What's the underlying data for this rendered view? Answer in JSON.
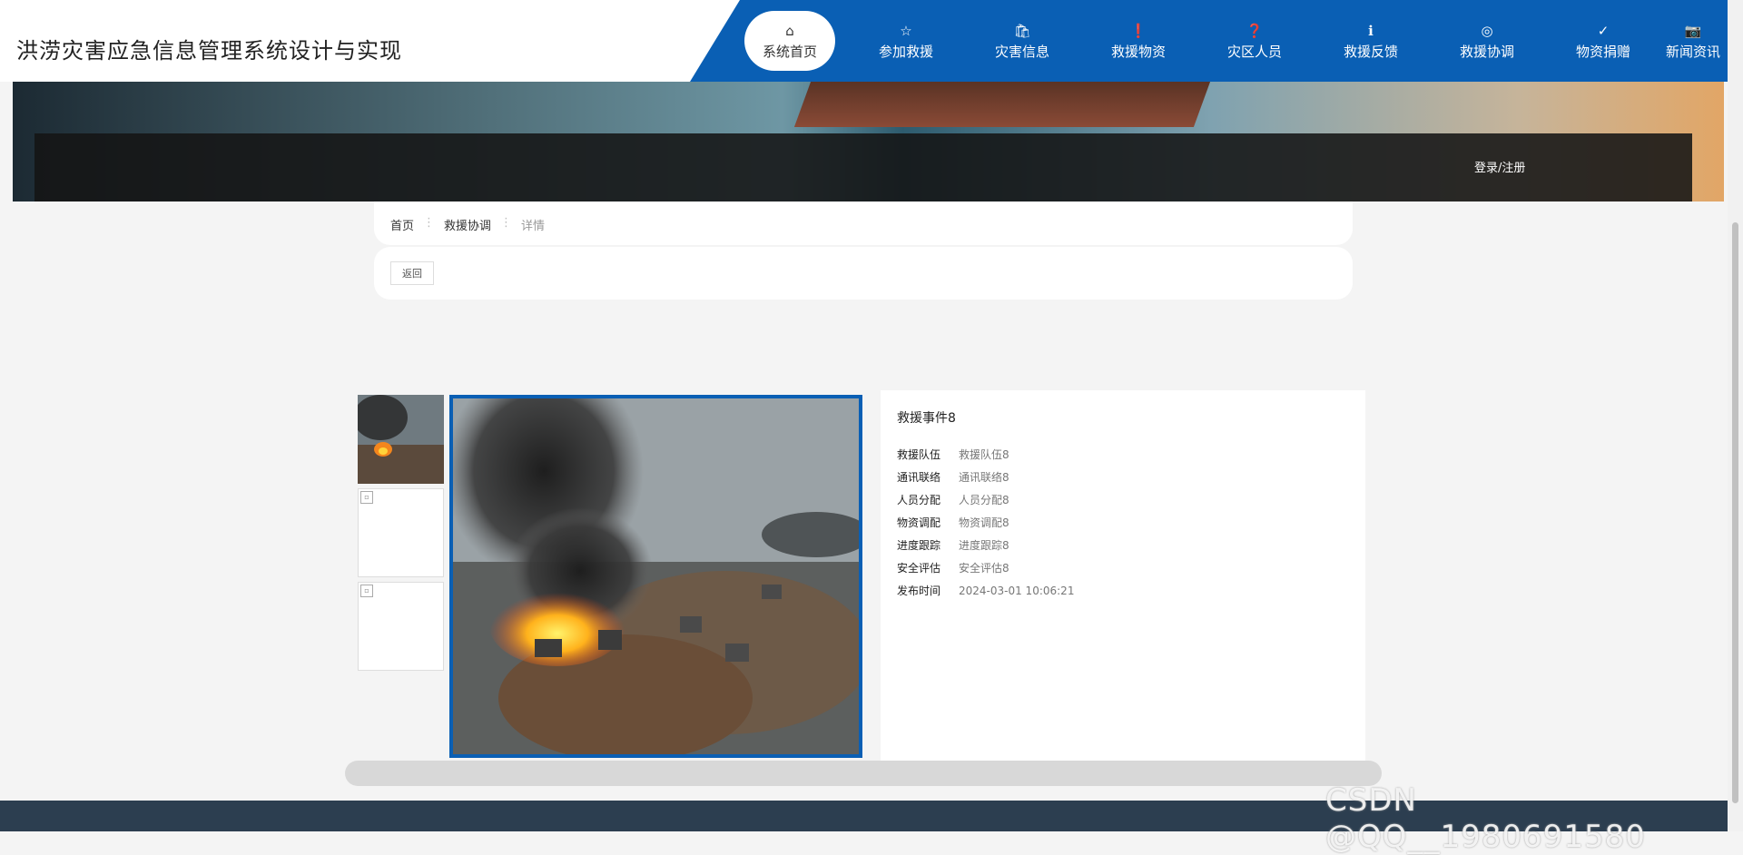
{
  "site": {
    "title": "洪涝灾害应急信息管理系统设计与实现"
  },
  "nav": {
    "items": [
      {
        "label": "系统首页",
        "icon": "home-icon",
        "glyph": "⌂"
      },
      {
        "label": "参加救援",
        "icon": "star-icon",
        "glyph": "☆"
      },
      {
        "label": "灾害信息",
        "icon": "bag-icon",
        "glyph": "🛍"
      },
      {
        "label": "救援物资",
        "icon": "info-icon",
        "glyph": "❗"
      },
      {
        "label": "灾区人员",
        "icon": "question-icon",
        "glyph": "❓"
      },
      {
        "label": "救援反馈",
        "icon": "info-circle-icon",
        "glyph": "ℹ"
      },
      {
        "label": "救援协调",
        "icon": "target-icon",
        "glyph": "◎"
      },
      {
        "label": "物资捐赠",
        "icon": "check-circle-icon",
        "glyph": "✓"
      },
      {
        "label": "新闻资讯",
        "icon": "camera-icon",
        "glyph": "📷"
      }
    ]
  },
  "banner": {
    "login": "登录/注册"
  },
  "breadcrumb": {
    "home": "首页",
    "category": "救援协调",
    "current": "详情",
    "sep": "⋮"
  },
  "actions": {
    "back": "返回"
  },
  "detail": {
    "title": "救援事件8",
    "rows": [
      {
        "label": "救援队伍",
        "value": "救援队伍8"
      },
      {
        "label": "通讯联络",
        "value": "通讯联络8"
      },
      {
        "label": "人员分配",
        "value": "人员分配8"
      },
      {
        "label": "物资调配",
        "value": "物资调配8"
      },
      {
        "label": "进度跟踪",
        "value": "进度跟踪8"
      },
      {
        "label": "安全评估",
        "value": "安全评估8"
      },
      {
        "label": "发布时间",
        "value": "2024-03-01 10:06:21"
      }
    ]
  },
  "watermark": "CSDN @QQ__1980691580",
  "colors": {
    "accent": "#0a5fb4",
    "footer": "#2c3e50"
  }
}
